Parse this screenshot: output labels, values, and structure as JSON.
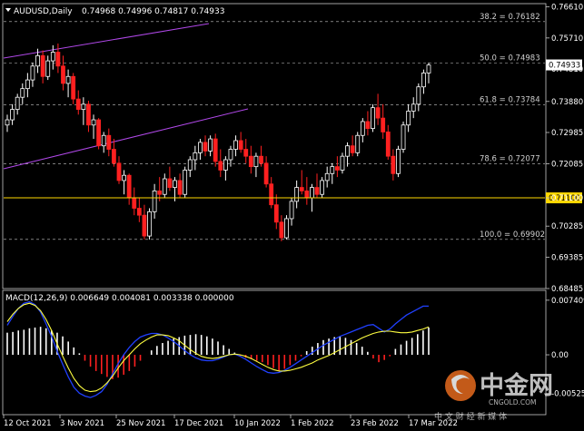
{
  "header": {
    "symbol_label": "AUDUSD,Daily",
    "ohlc": "0.74968 0.74996 0.74817 0.74933"
  },
  "price_axis": {
    "ticks": [
      "0.76610",
      "0.75710",
      "0.74810",
      "0.73880",
      "0.72985",
      "0.72085",
      "0.71100",
      "0.70285",
      "0.69385",
      "0.68485"
    ],
    "current_price": "0.74933",
    "level_line": "0.71100",
    "level_color": "#ffd700"
  },
  "fib_levels": [
    {
      "label": "38.2 = 0.76182",
      "value": 0.76182
    },
    {
      "label": "50.0 = 0.74983",
      "value": 0.74983
    },
    {
      "label": "61.8 = 0.73784",
      "value": 0.73784
    },
    {
      "label": "78.6 = 0.72077",
      "value": 0.72077
    },
    {
      "label": "100.0 = 0.69902",
      "value": 0.69902
    }
  ],
  "date_axis": [
    "12 Oct 2021",
    "3 Nov 2021",
    "25 Nov 2021",
    "17 Dec 2021",
    "10 Jan 2022",
    "1 Feb 2022",
    "23 Feb 2022",
    "17 Mar 2022"
  ],
  "macd": {
    "label": "MACD(12,26,9) 0.006649 0.004081 0.003338 0.000000",
    "ticks": [
      "0.007409",
      "0.00",
      "-0.005259"
    ]
  },
  "watermark": {
    "brand": "中金网",
    "site": "CNGOLD.COM",
    "slogan": "中 文 财 经 新 媒 体"
  },
  "chart_data": {
    "type": "candlestick",
    "ylim": [
      0.68485,
      0.767
    ],
    "candles": [
      [
        0.732,
        0.735,
        0.73,
        0.7335
      ],
      [
        0.7335,
        0.738,
        0.732,
        0.7365
      ],
      [
        0.7365,
        0.741,
        0.735,
        0.74
      ],
      [
        0.74,
        0.744,
        0.738,
        0.7425
      ],
      [
        0.7425,
        0.747,
        0.74,
        0.745
      ],
      [
        0.745,
        0.75,
        0.743,
        0.749
      ],
      [
        0.749,
        0.754,
        0.747,
        0.752
      ],
      [
        0.752,
        0.7535,
        0.744,
        0.746
      ],
      [
        0.746,
        0.752,
        0.745,
        0.7505
      ],
      [
        0.7505,
        0.755,
        0.748,
        0.753
      ],
      [
        0.753,
        0.7555,
        0.747,
        0.749
      ],
      [
        0.749,
        0.752,
        0.742,
        0.744
      ],
      [
        0.744,
        0.748,
        0.74,
        0.746
      ],
      [
        0.746,
        0.747,
        0.738,
        0.7395
      ],
      [
        0.7395,
        0.742,
        0.735,
        0.7365
      ],
      [
        0.7365,
        0.74,
        0.732,
        0.738
      ],
      [
        0.738,
        0.739,
        0.73,
        0.732
      ],
      [
        0.732,
        0.735,
        0.728,
        0.7335
      ],
      [
        0.7335,
        0.734,
        0.725,
        0.726
      ],
      [
        0.726,
        0.73,
        0.724,
        0.729
      ],
      [
        0.729,
        0.731,
        0.723,
        0.725
      ],
      [
        0.725,
        0.728,
        0.72,
        0.721
      ],
      [
        0.721,
        0.723,
        0.715,
        0.716
      ],
      [
        0.716,
        0.719,
        0.712,
        0.7175
      ],
      [
        0.7175,
        0.718,
        0.709,
        0.711
      ],
      [
        0.711,
        0.714,
        0.706,
        0.708
      ],
      [
        0.708,
        0.711,
        0.704,
        0.706
      ],
      [
        0.706,
        0.709,
        0.699,
        0.7
      ],
      [
        0.7,
        0.708,
        0.699,
        0.707
      ],
      [
        0.707,
        0.715,
        0.705,
        0.713
      ],
      [
        0.713,
        0.717,
        0.71,
        0.712
      ],
      [
        0.712,
        0.718,
        0.711,
        0.7165
      ],
      [
        0.7165,
        0.72,
        0.713,
        0.714
      ],
      [
        0.714,
        0.717,
        0.71,
        0.716
      ],
      [
        0.716,
        0.718,
        0.711,
        0.712
      ],
      [
        0.712,
        0.72,
        0.711,
        0.719
      ],
      [
        0.719,
        0.723,
        0.717,
        0.722
      ],
      [
        0.722,
        0.726,
        0.719,
        0.724
      ],
      [
        0.724,
        0.728,
        0.722,
        0.727
      ],
      [
        0.727,
        0.729,
        0.723,
        0.7245
      ],
      [
        0.7245,
        0.729,
        0.723,
        0.728
      ],
      [
        0.728,
        0.7295,
        0.72,
        0.7215
      ],
      [
        0.7215,
        0.725,
        0.717,
        0.719
      ],
      [
        0.719,
        0.723,
        0.716,
        0.722
      ],
      [
        0.722,
        0.726,
        0.72,
        0.725
      ],
      [
        0.725,
        0.729,
        0.723,
        0.7275
      ],
      [
        0.7275,
        0.73,
        0.724,
        0.725
      ],
      [
        0.725,
        0.728,
        0.721,
        0.723
      ],
      [
        0.723,
        0.726,
        0.718,
        0.72
      ],
      [
        0.72,
        0.724,
        0.717,
        0.723
      ],
      [
        0.723,
        0.726,
        0.72,
        0.721
      ],
      [
        0.721,
        0.723,
        0.714,
        0.715
      ],
      [
        0.715,
        0.717,
        0.708,
        0.709
      ],
      [
        0.709,
        0.712,
        0.702,
        0.704
      ],
      [
        0.704,
        0.706,
        0.6985,
        0.6995
      ],
      [
        0.6995,
        0.706,
        0.699,
        0.705
      ],
      [
        0.705,
        0.711,
        0.703,
        0.71
      ],
      [
        0.71,
        0.716,
        0.708,
        0.714
      ],
      [
        0.714,
        0.719,
        0.712,
        0.713
      ],
      [
        0.713,
        0.717,
        0.709,
        0.711
      ],
      [
        0.711,
        0.715,
        0.707,
        0.714
      ],
      [
        0.714,
        0.718,
        0.711,
        0.712
      ],
      [
        0.712,
        0.717,
        0.711,
        0.716
      ],
      [
        0.716,
        0.72,
        0.714,
        0.718
      ],
      [
        0.718,
        0.721,
        0.715,
        0.72
      ],
      [
        0.72,
        0.723,
        0.717,
        0.719
      ],
      [
        0.719,
        0.724,
        0.718,
        0.723
      ],
      [
        0.723,
        0.727,
        0.72,
        0.726
      ],
      [
        0.726,
        0.729,
        0.723,
        0.724
      ],
      [
        0.724,
        0.73,
        0.723,
        0.729
      ],
      [
        0.729,
        0.734,
        0.727,
        0.733
      ],
      [
        0.733,
        0.736,
        0.729,
        0.731
      ],
      [
        0.731,
        0.738,
        0.73,
        0.737
      ],
      [
        0.737,
        0.741,
        0.732,
        0.734
      ],
      [
        0.734,
        0.738,
        0.728,
        0.73
      ],
      [
        0.73,
        0.732,
        0.722,
        0.723
      ],
      [
        0.723,
        0.725,
        0.716,
        0.718
      ],
      [
        0.718,
        0.726,
        0.717,
        0.725
      ],
      [
        0.725,
        0.733,
        0.724,
        0.732
      ],
      [
        0.732,
        0.738,
        0.73,
        0.736
      ],
      [
        0.736,
        0.74,
        0.734,
        0.738
      ],
      [
        0.738,
        0.744,
        0.736,
        0.743
      ],
      [
        0.743,
        0.748,
        0.741,
        0.747
      ],
      [
        0.747,
        0.75,
        0.744,
        0.7493
      ]
    ],
    "macd_hist": [
      0.003,
      0.0031,
      0.0033,
      0.0034,
      0.0036,
      0.0037,
      0.0038,
      0.0036,
      0.0033,
      0.003,
      0.0025,
      0.0018,
      0.001,
      0.0002,
      -0.0008,
      -0.0016,
      -0.0022,
      -0.0026,
      -0.003,
      -0.0033,
      -0.0031,
      -0.0027,
      -0.0022,
      -0.0016,
      -0.0008,
      0.0,
      0.0006,
      0.0012,
      0.0016,
      0.0019,
      0.0022,
      0.0024,
      0.0026,
      0.0027,
      0.0028,
      0.0027,
      0.0025,
      0.0022,
      0.0018,
      0.0013,
      0.0008,
      0.0003,
      -0.0002,
      -0.0004,
      -0.0006,
      -0.0008,
      -0.001,
      -0.0014,
      -0.0018,
      -0.0022,
      -0.0019,
      -0.0014,
      -0.0008,
      -0.0002,
      0.0005,
      0.0011,
      0.0016,
      0.002,
      0.0022,
      0.0024,
      0.0025,
      0.0023,
      0.002,
      0.0016,
      0.0011,
      0.0004,
      -0.0005,
      -0.001,
      -0.0007,
      -0.0002,
      0.0008,
      0.0014,
      0.0019,
      0.0023,
      0.0028,
      0.0033,
      0.0037
    ],
    "macd_signal": [
      0.0045,
      0.0055,
      0.0063,
      0.0068,
      0.007,
      0.0067,
      0.006,
      0.0048,
      0.0033,
      0.0015,
      -0.0002,
      -0.0018,
      -0.0032,
      -0.0042,
      -0.0048,
      -0.005,
      -0.0049,
      -0.0045,
      -0.0038,
      -0.0029,
      -0.0018,
      -0.0008,
      0.0,
      0.0008,
      0.0015,
      0.002,
      0.0024,
      0.0027,
      0.0027,
      0.0026,
      0.0023,
      0.0019,
      0.0013,
      0.0007,
      0.0002,
      -0.0002,
      -0.0004,
      -0.0005,
      -0.0004,
      -0.0002,
      0.0,
      0.0001,
      0.0,
      -0.0002,
      -0.0005,
      -0.0009,
      -0.0013,
      -0.0017,
      -0.002,
      -0.0022,
      -0.0022,
      -0.0021,
      -0.0019,
      -0.0017,
      -0.0014,
      -0.0011,
      -0.0007,
      -0.0004,
      -0.0001,
      0.0003,
      0.0007,
      0.0011,
      0.0015,
      0.0019,
      0.0023,
      0.0026,
      0.0029,
      0.0031,
      0.0032,
      0.0032,
      0.0031,
      0.003,
      0.003,
      0.0031,
      0.0033,
      0.0035,
      0.0038
    ],
    "macd_line": [
      0.004,
      0.0052,
      0.0063,
      0.007,
      0.0072,
      0.0068,
      0.0058,
      0.0042,
      0.0025,
      0.0005,
      -0.0013,
      -0.003,
      -0.0044,
      -0.0052,
      -0.0056,
      -0.0058,
      -0.0055,
      -0.005,
      -0.004,
      -0.0026,
      -0.0012,
      0.0,
      0.001,
      0.0018,
      0.0024,
      0.0027,
      0.0029,
      0.0029,
      0.0027,
      0.0023,
      0.0018,
      0.0012,
      0.0006,
      0.0,
      -0.0004,
      -0.0007,
      -0.0008,
      -0.0008,
      -0.0006,
      -0.0003,
      0.0,
      0.0001,
      -0.0002,
      -0.0006,
      -0.0011,
      -0.0016,
      -0.002,
      -0.0024,
      -0.0025,
      -0.0024,
      -0.0021,
      -0.0017,
      -0.0012,
      -0.0007,
      -0.0002,
      0.0003,
      0.0008,
      0.0013,
      0.0017,
      0.0021,
      0.0025,
      0.0028,
      0.0031,
      0.0034,
      0.0037,
      0.004,
      0.0041,
      0.0036,
      0.0031,
      0.0035,
      0.0042,
      0.0048,
      0.0054,
      0.0058,
      0.0062,
      0.0066,
      0.0066
    ]
  }
}
